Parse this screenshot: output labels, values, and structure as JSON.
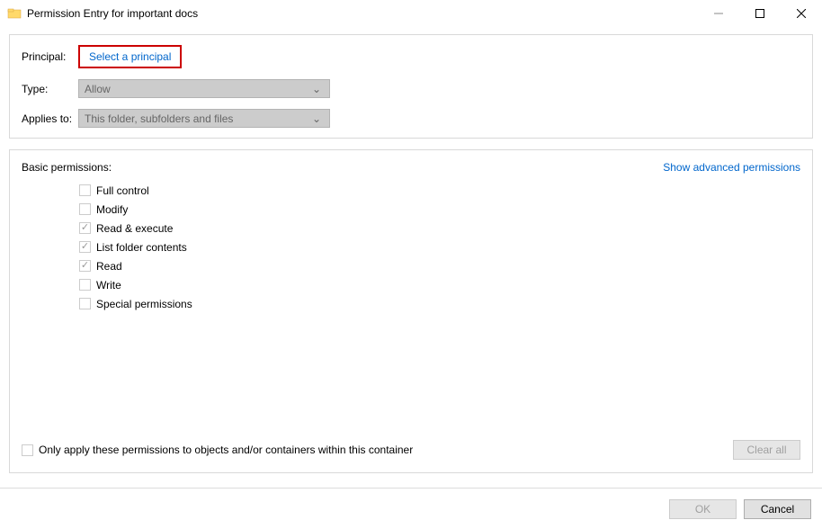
{
  "window": {
    "title": "Permission Entry for important docs"
  },
  "form": {
    "principal_label": "Principal:",
    "principal_link": "Select a principal",
    "type_label": "Type:",
    "type_value": "Allow",
    "applies_label": "Applies to:",
    "applies_value": "This folder, subfolders and files"
  },
  "permissions": {
    "title": "Basic permissions:",
    "advanced_link": "Show advanced permissions",
    "items": [
      {
        "label": "Full control",
        "checked": false
      },
      {
        "label": "Modify",
        "checked": false
      },
      {
        "label": "Read & execute",
        "checked": true
      },
      {
        "label": "List folder contents",
        "checked": true
      },
      {
        "label": "Read",
        "checked": true
      },
      {
        "label": "Write",
        "checked": false
      },
      {
        "label": "Special permissions",
        "checked": false
      }
    ],
    "only_apply": "Only apply these permissions to objects and/or containers within this container",
    "clear_all": "Clear all"
  },
  "buttons": {
    "ok": "OK",
    "cancel": "Cancel"
  }
}
